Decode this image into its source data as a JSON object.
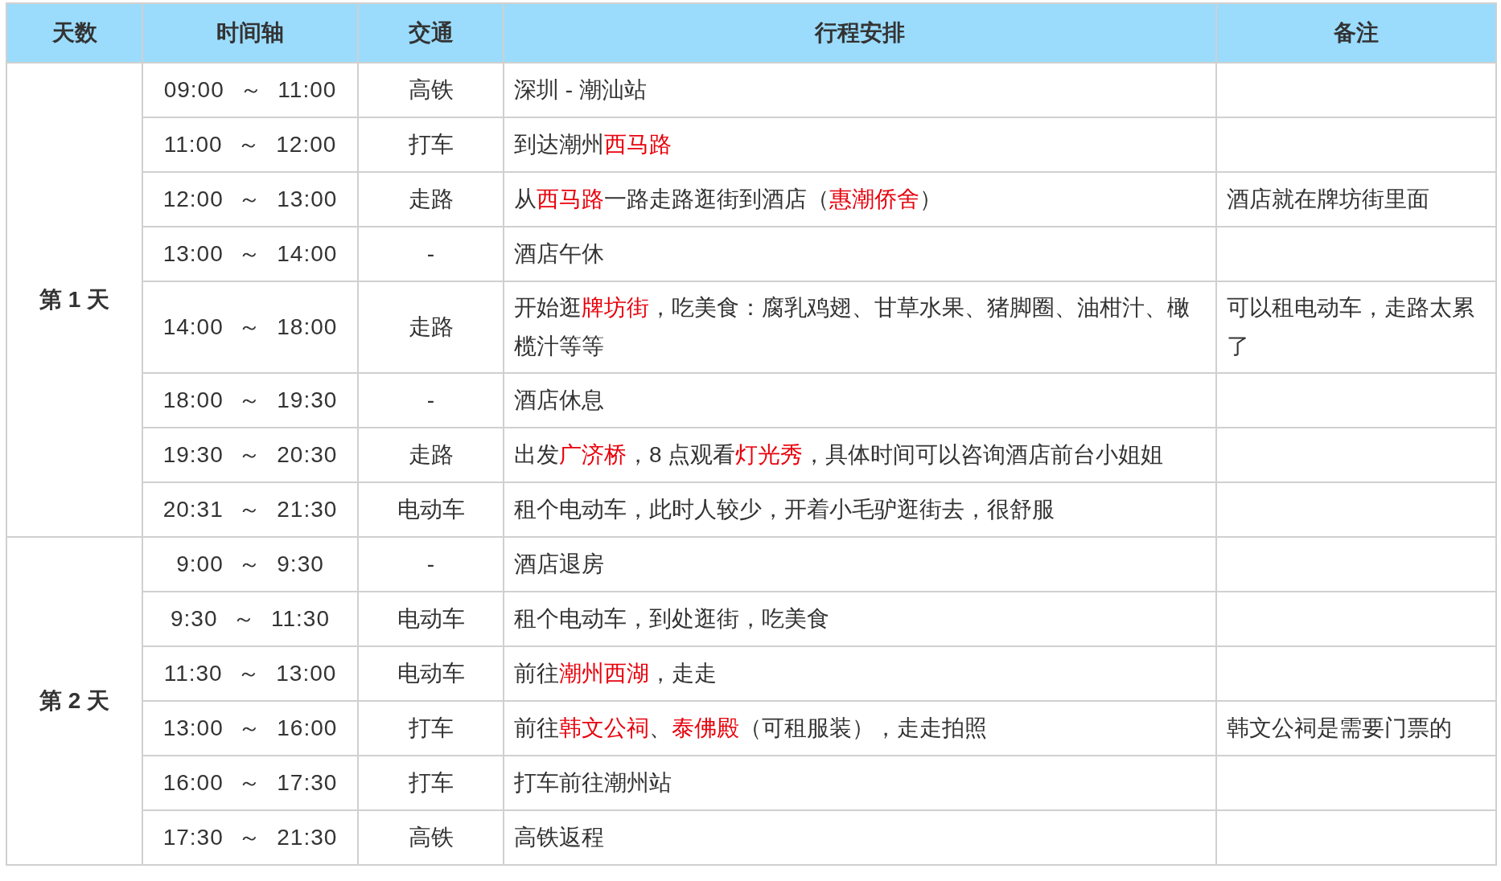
{
  "table": {
    "columns": [
      "天数",
      "时间轴",
      "交通",
      "行程安排",
      "备注"
    ],
    "days": [
      {
        "label": "第 1 天",
        "rows": [
          {
            "time": "09:00 ～ 11:00",
            "transport": "高铁",
            "plan": [
              {
                "text": "深圳 - 潮汕站",
                "highlight": false
              }
            ]
          },
          {
            "time": "11:00 ～ 12:00",
            "transport": "打车",
            "plan": [
              {
                "text": "到达潮州",
                "highlight": false
              },
              {
                "text": "西马路",
                "highlight": true
              }
            ]
          },
          {
            "time": "12:00 ～ 13:00",
            "transport": "走路",
            "plan": [
              {
                "text": "从",
                "highlight": false
              },
              {
                "text": "西马路",
                "highlight": true
              },
              {
                "text": "一路走路逛街到酒店（",
                "highlight": false
              },
              {
                "text": "惠潮侨舍",
                "highlight": true
              },
              {
                "text": "）",
                "highlight": false
              }
            ],
            "note": "酒店就在牌坊街里面"
          },
          {
            "time": "13:00 ～ 14:00",
            "transport": "-",
            "plan": [
              {
                "text": "酒店午休",
                "highlight": false
              }
            ]
          },
          {
            "time": "14:00 ～ 18:00",
            "transport": "走路",
            "plan": [
              {
                "text": "开始逛",
                "highlight": false
              },
              {
                "text": "牌坊街",
                "highlight": true
              },
              {
                "text": "，吃美食：腐乳鸡翅、甘草水果、猪脚圈、油柑汁、橄榄汁等等",
                "highlight": false
              }
            ],
            "note": "可以租电动车，走路太累了"
          },
          {
            "time": "18:00 ～ 19:30",
            "transport": "-",
            "plan": [
              {
                "text": "酒店休息",
                "highlight": false
              }
            ]
          },
          {
            "time": "19:30 ～ 20:30",
            "transport": "走路",
            "plan": [
              {
                "text": "出发",
                "highlight": false
              },
              {
                "text": "广济桥",
                "highlight": true
              },
              {
                "text": "，8 点观看",
                "highlight": false
              },
              {
                "text": "灯光秀",
                "highlight": true
              },
              {
                "text": "，具体时间可以咨询酒店前台小姐姐",
                "highlight": false
              }
            ]
          },
          {
            "time": "20:31 ～ 21:30",
            "transport": "电动车",
            "plan": [
              {
                "text": "租个电动车，此时人较少，开着小毛驴逛街去，很舒服",
                "highlight": false
              }
            ]
          }
        ]
      },
      {
        "label": "第 2 天",
        "rows": [
          {
            "time": "9:00 ～ 9:30",
            "transport": "-",
            "plan": [
              {
                "text": "酒店退房",
                "highlight": false
              }
            ]
          },
          {
            "time": "9:30 ～ 11:30",
            "transport": "电动车",
            "plan": [
              {
                "text": "租个电动车，到处逛街，吃美食",
                "highlight": false
              }
            ]
          },
          {
            "time": "11:30 ～ 13:00",
            "transport": "电动车",
            "plan": [
              {
                "text": "前往",
                "highlight": false
              },
              {
                "text": "潮州西湖",
                "highlight": true
              },
              {
                "text": "，走走",
                "highlight": false
              }
            ]
          },
          {
            "time": "13:00 ～ 16:00",
            "transport": "打车",
            "plan": [
              {
                "text": "前往",
                "highlight": false
              },
              {
                "text": "韩文公祠",
                "highlight": true
              },
              {
                "text": "、",
                "highlight": false
              },
              {
                "text": "泰佛殿",
                "highlight": true
              },
              {
                "text": "（可租服装），走走拍照",
                "highlight": false
              }
            ],
            "note": "韩文公祠是需要门票的"
          },
          {
            "time": "16:00 ～ 17:30",
            "transport": "打车",
            "plan": [
              {
                "text": "打车前往潮州站",
                "highlight": false
              }
            ]
          },
          {
            "time": "17:30 ～ 21:30",
            "transport": "高铁",
            "plan": [
              {
                "text": "高铁返程",
                "highlight": false
              }
            ]
          }
        ]
      }
    ]
  }
}
